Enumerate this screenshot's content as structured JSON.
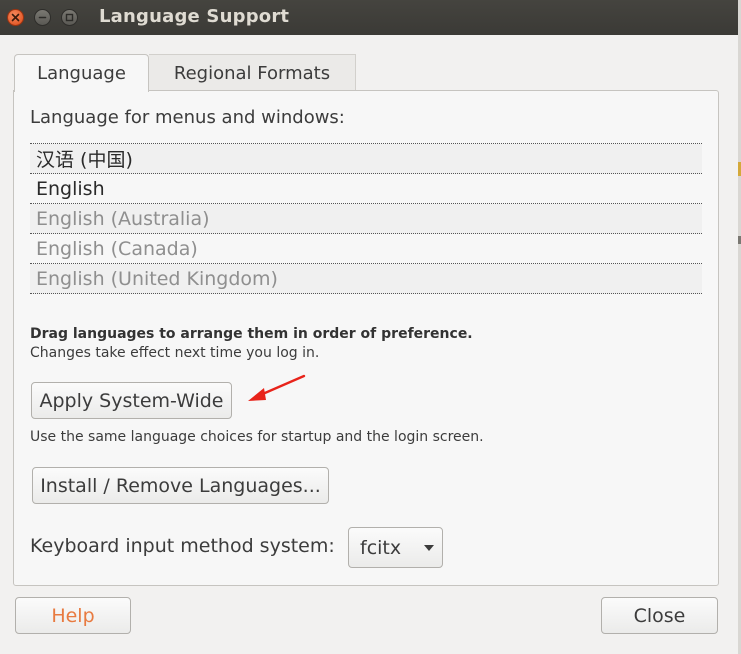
{
  "window": {
    "title": "Language Support"
  },
  "tabs": [
    {
      "label": "Language",
      "selected": true
    },
    {
      "label": "Regional Formats",
      "selected": false
    }
  ],
  "language_section": {
    "heading": "Language for menus and windows:",
    "items": [
      {
        "label": "汉语 (中国)",
        "state": "active"
      },
      {
        "label": "English",
        "state": "active"
      },
      {
        "label": "English (Australia)",
        "state": "inactive"
      },
      {
        "label": "English (Canada)",
        "state": "inactive"
      },
      {
        "label": "English (United Kingdom)",
        "state": "inactive"
      }
    ],
    "hint_bold": "Drag languages to arrange them in order of preference.",
    "hint": "Changes take effect next time you log in."
  },
  "actions": {
    "apply_label": "Apply System-Wide",
    "apply_note": "Use the same language choices for startup and the login screen.",
    "install_label": "Install / Remove Languages..."
  },
  "keyboard": {
    "label": "Keyboard input method system:",
    "value": "fcitx"
  },
  "footer": {
    "help_label": "Help",
    "close_label": "Close"
  },
  "colors": {
    "titlebar": "#3b3a36",
    "close_button": "#df4a16",
    "help_text": "#e87a40",
    "annotation_arrow": "#e8231a"
  },
  "icons": {
    "window_close": "close-icon",
    "window_minimize": "minimize-icon",
    "window_maximize": "maximize-icon",
    "combo": "chevron-down-icon",
    "annotation": "red-arrow-icon"
  }
}
